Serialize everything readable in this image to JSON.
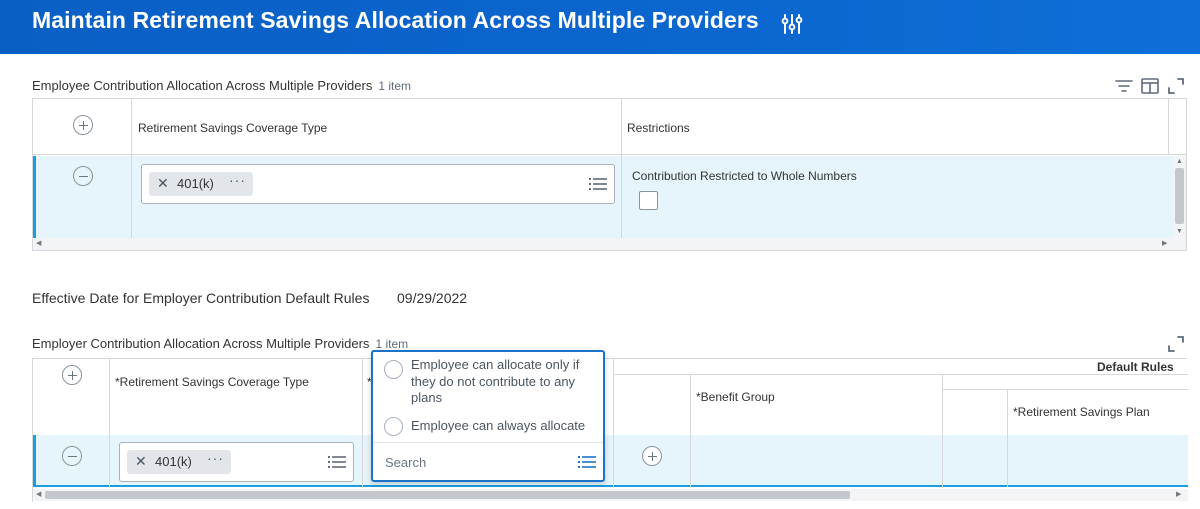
{
  "header": {
    "title": "Maintain Retirement Savings Allocation Across Multiple Providers",
    "settings_icon": "sliders-icon"
  },
  "employee_section": {
    "title": "Employee Contribution Allocation Across Multiple Providers",
    "count": "1 item",
    "tools": [
      "filter-icon",
      "columns-icon",
      "expand-icon"
    ],
    "columns": [
      "Retirement Savings Coverage Type",
      "Restrictions"
    ],
    "rows": [
      {
        "coverage_type": "401(k)",
        "restriction_label": "Contribution Restricted to Whole Numbers",
        "restricted_checked": false
      }
    ]
  },
  "effective_date": {
    "label": "Effective Date for Employer Contribution Default Rules",
    "value": "09/29/2022"
  },
  "employer_section": {
    "title": "Employer Contribution Allocation Across Multiple Providers",
    "count": "1 item",
    "group_header": "Default Rules",
    "columns": {
      "coverage_type": "*Retirement Savings Coverage Type",
      "second_col_marker": "*",
      "benefit_group": "*Benefit Group",
      "savings_plan": "*Retirement Savings Plan"
    },
    "rows": [
      {
        "coverage_type": "401(k)"
      }
    ]
  },
  "dropdown": {
    "options": [
      "Employee can allocate only if they do not contribute to any plans",
      "Employee can always allocate"
    ],
    "search_placeholder": "Search"
  },
  "colors": {
    "header_blue": "#0b66cf",
    "row_highlight": "#e6f5fb",
    "accent_blue": "#1a9ee0",
    "dropdown_border": "#1a73c9"
  }
}
